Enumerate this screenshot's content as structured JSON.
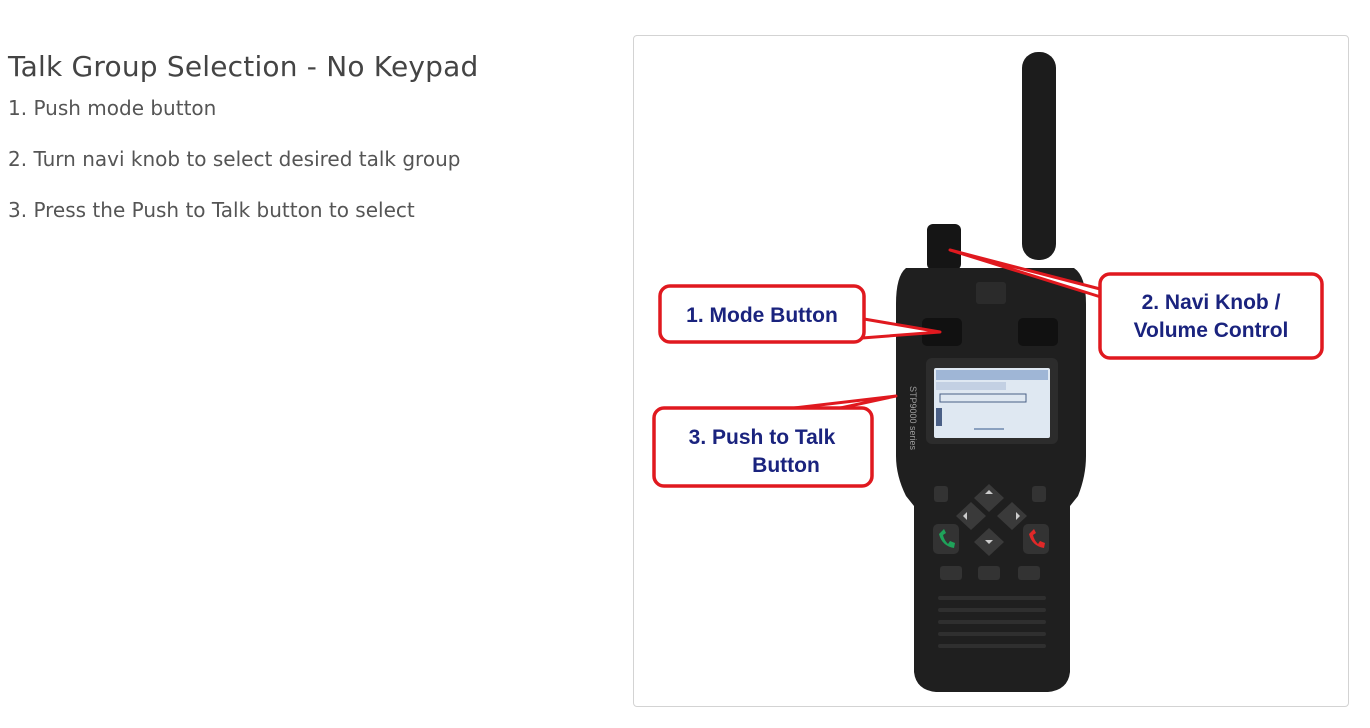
{
  "section": {
    "title": "Talk Group Selection - No Keypad",
    "steps": [
      "1. Push mode button",
      "2. Turn navi knob to select desired talk group",
      "3. Press the Push to Talk button to select"
    ]
  },
  "figure": {
    "callouts": {
      "mode_button": "1. Mode Button",
      "navi_knob_line1": "2. Navi Knob /",
      "navi_knob_line2": "Volume Control",
      "ptt_line1": "3. Push to Talk",
      "ptt_line2": "Button"
    },
    "device_brand": "STP9000 series",
    "callout_color": "#e0191f",
    "callout_text_color": "#1a237e"
  }
}
